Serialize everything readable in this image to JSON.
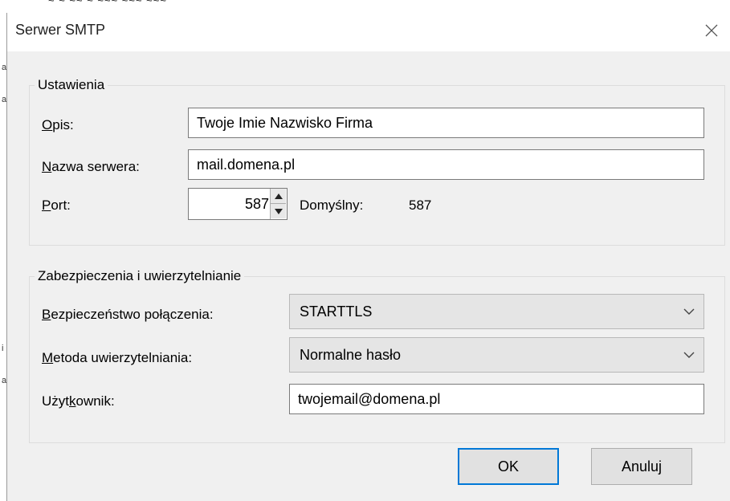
{
  "dialog": {
    "title": "Serwer SMTP",
    "close_icon": "close-icon"
  },
  "settings": {
    "legend": "Ustawienia",
    "description_label": "Opis:",
    "description_value": "Twoje Imie Nazwisko Firma",
    "server_label": "Nazwa serwera:",
    "server_value": "mail.domena.pl",
    "port_label": "Port:",
    "port_value": "587",
    "default_label": "Domyślny:",
    "default_value": "587"
  },
  "security": {
    "legend": "Zabezpieczenia i uwierzytelnianie",
    "connection_label": "Bezpieczeństwo połączenia:",
    "connection_value": "STARTTLS",
    "auth_label": "Metoda uwierzytelniania:",
    "auth_value": "Normalne hasło",
    "user_label": "Użytkownik:",
    "user_value": "twojemail@domena.pl"
  },
  "buttons": {
    "ok": "OK",
    "cancel": "Anuluj"
  },
  "colors": {
    "accent": "#0078d7",
    "dialog_bg": "#f0f0f0"
  }
}
